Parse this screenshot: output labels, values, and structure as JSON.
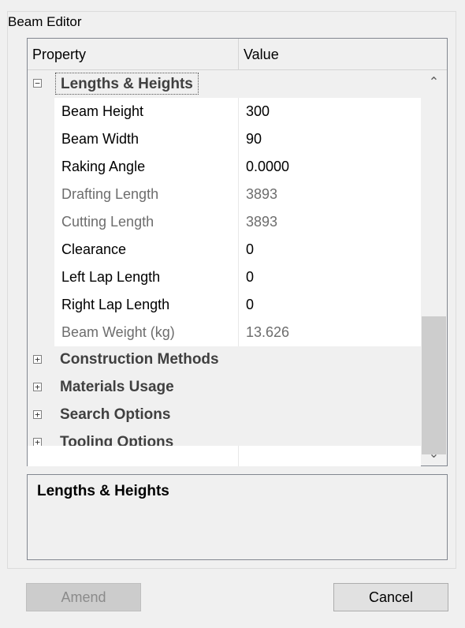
{
  "window": {
    "group_title": "Beam Editor"
  },
  "grid": {
    "header": {
      "property": "Property",
      "value": "Value"
    },
    "categories": [
      {
        "label": "Lengths & Heights",
        "expanded": true,
        "expander": "−"
      },
      {
        "label": "Construction Methods",
        "expanded": false,
        "expander": "+"
      },
      {
        "label": "Materials Usage",
        "expanded": false,
        "expander": "+"
      },
      {
        "label": "Search Options",
        "expanded": false,
        "expander": "+"
      },
      {
        "label": "Tooling Options",
        "expanded": false,
        "expander": "+"
      }
    ],
    "properties": [
      {
        "name": "Beam Height",
        "value": "300",
        "readonly": false
      },
      {
        "name": "Beam Width",
        "value": "90",
        "readonly": false
      },
      {
        "name": "Raking Angle",
        "value": "0.0000",
        "readonly": false
      },
      {
        "name": "Drafting Length",
        "value": "3893",
        "readonly": true
      },
      {
        "name": "Cutting Length",
        "value": "3893",
        "readonly": true
      },
      {
        "name": "Clearance",
        "value": "0",
        "readonly": false
      },
      {
        "name": "Left Lap Length",
        "value": "0",
        "readonly": false
      },
      {
        "name": "Right Lap Length",
        "value": "0",
        "readonly": false
      },
      {
        "name": "Beam Weight (kg)",
        "value": "13.626",
        "readonly": true
      }
    ],
    "scrollbar": {
      "up_icon": "chevron-up-icon",
      "down_icon": "chevron-down-icon"
    }
  },
  "description": {
    "title": "Lengths & Heights"
  },
  "buttons": {
    "amend": "Amend",
    "cancel": "Cancel",
    "amend_enabled": false
  }
}
